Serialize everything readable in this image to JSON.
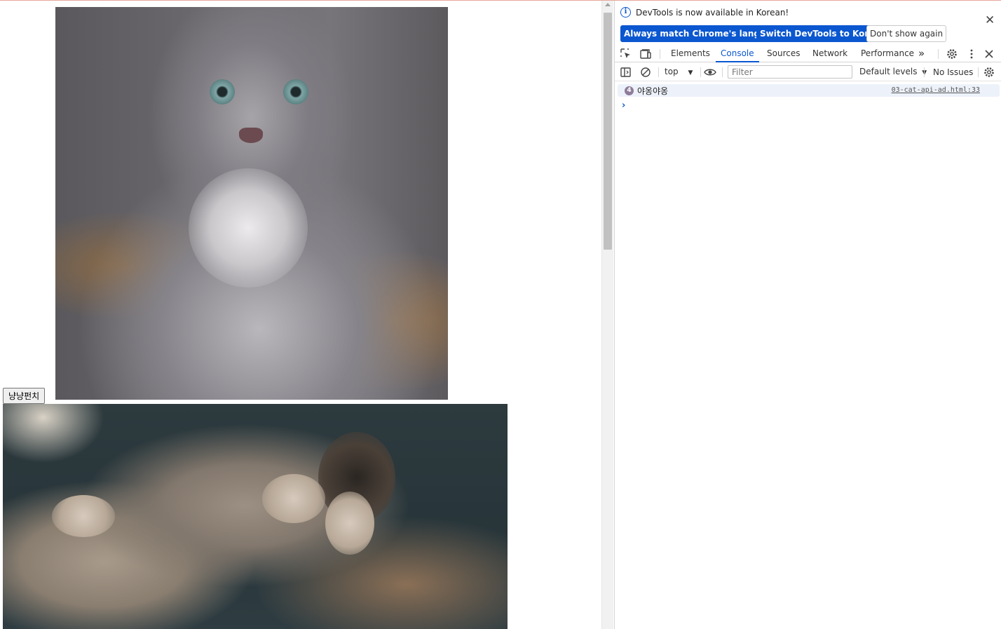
{
  "page": {
    "button_label": "냥냥펀치"
  },
  "devtools": {
    "infobar": {
      "message": "DevTools is now available in Korean!",
      "btn_match": "Always match Chrome's language",
      "btn_switch": "Switch DevTools to Korean",
      "btn_dismiss": "Don't show again",
      "close": "✕"
    },
    "tabs": {
      "elements": "Elements",
      "console": "Console",
      "sources": "Sources",
      "network": "Network",
      "performance": "Performance",
      "more": "»"
    },
    "toolbar": {
      "context": "top",
      "filter_placeholder": "Filter",
      "levels": "Default levels",
      "issues": "No Issues"
    },
    "console": {
      "log_count": "4",
      "log_message": "야옹야옹",
      "log_source": "03-cat-api-ad.html:33",
      "prompt": "›"
    }
  },
  "colors": {
    "accent": "#0b57d0",
    "log_row_bg": "#edf2fa",
    "badge": "#8e7c9a"
  }
}
